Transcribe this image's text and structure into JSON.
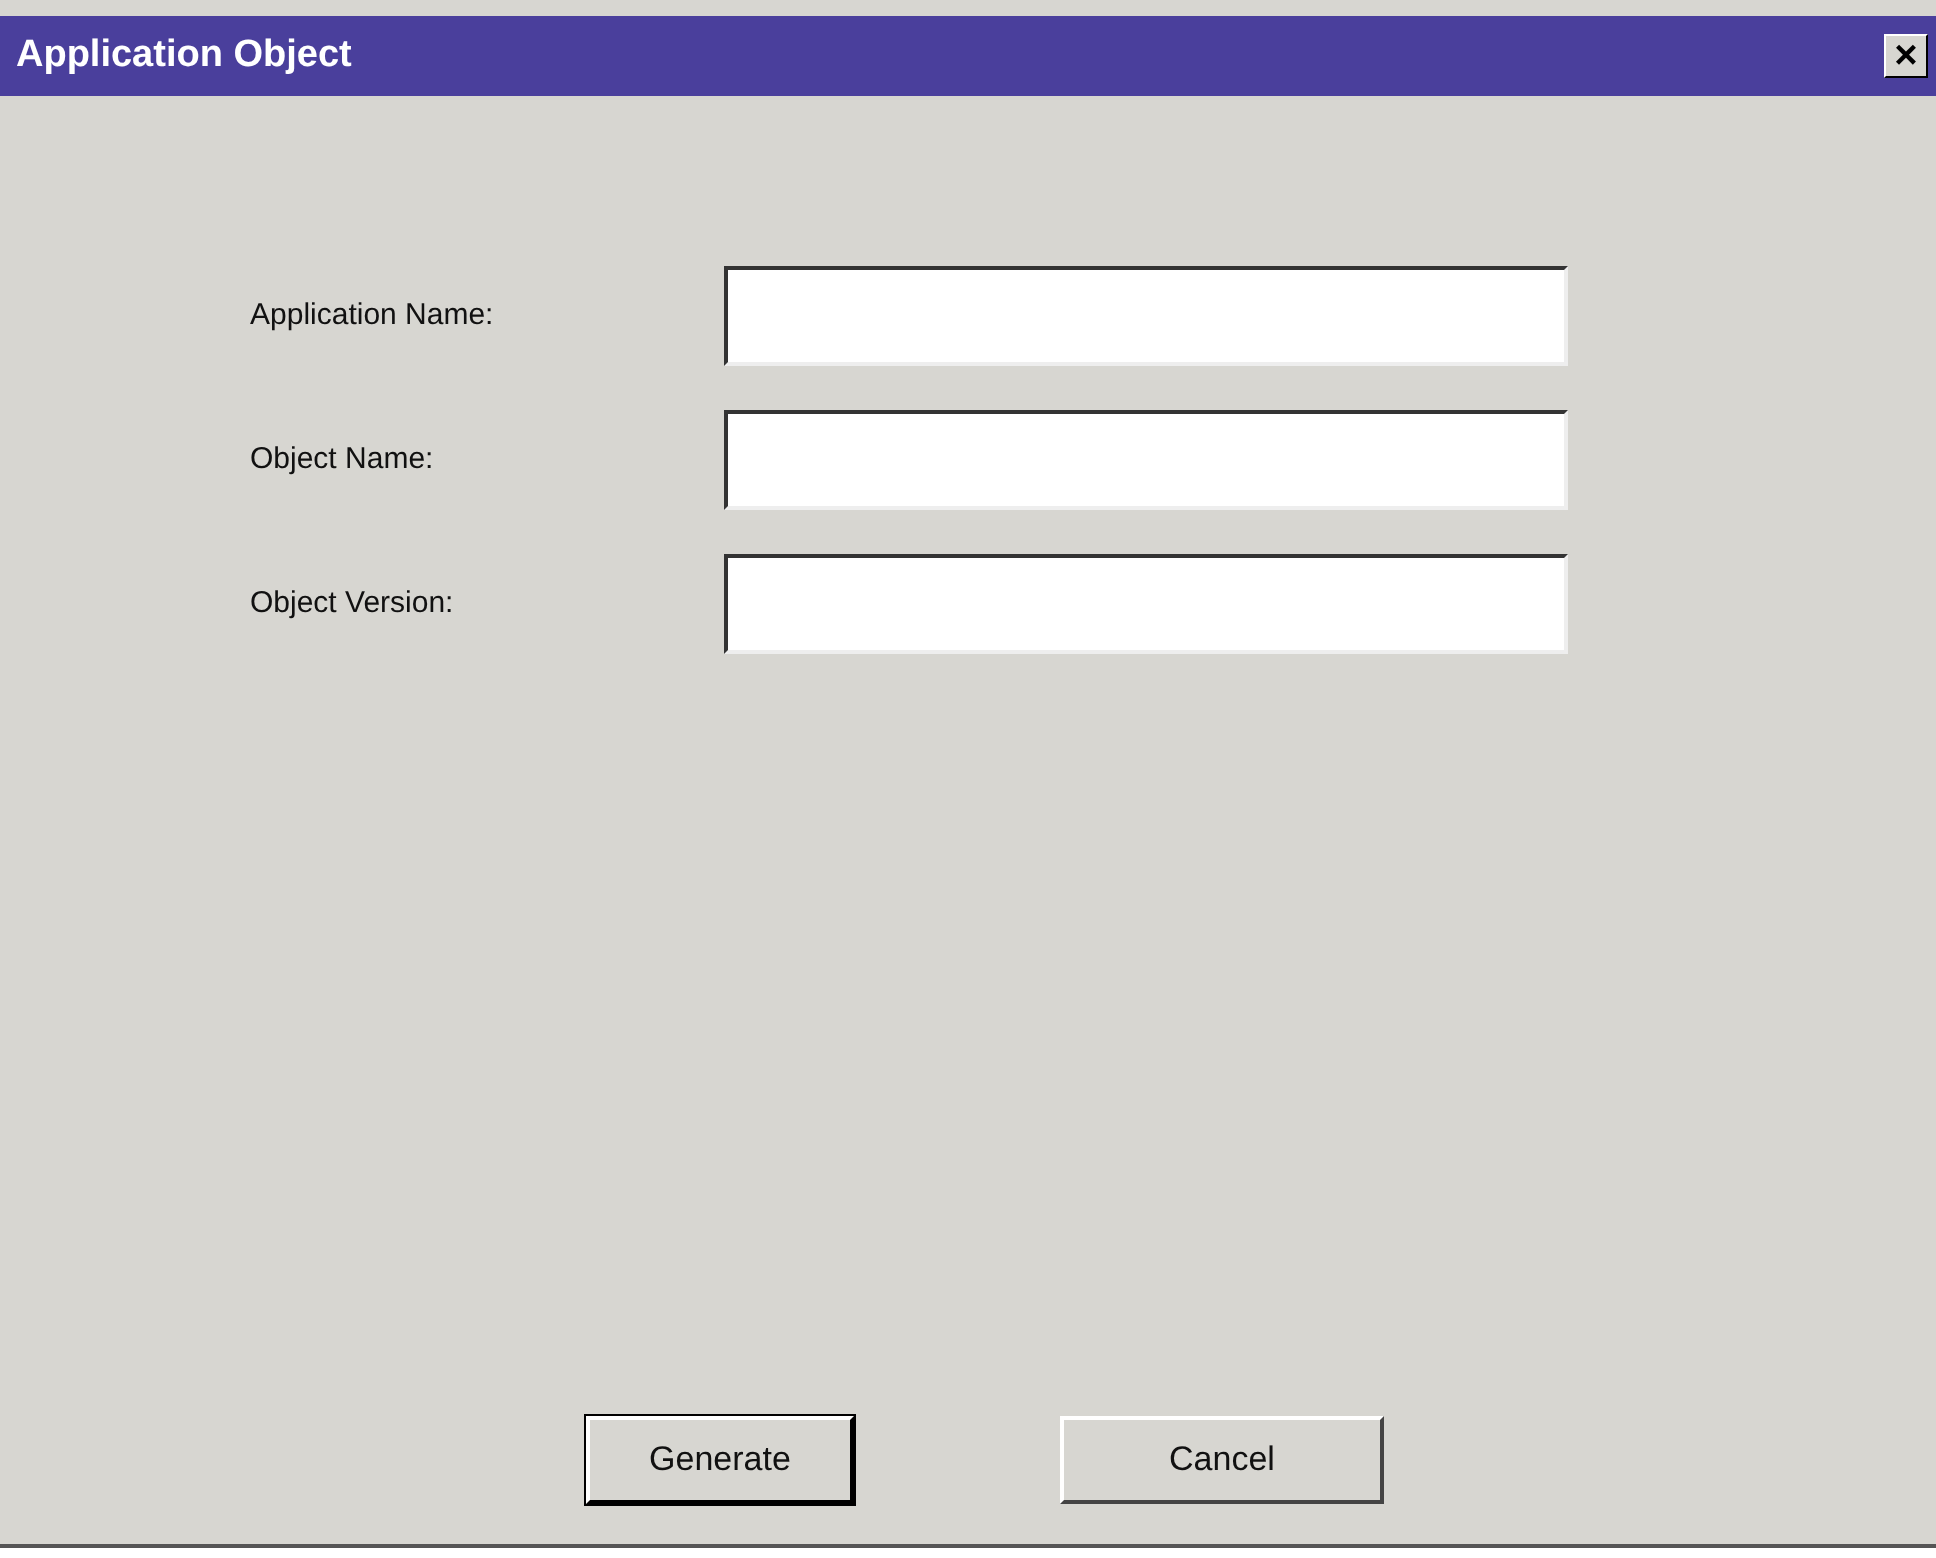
{
  "window": {
    "title": "Application Object",
    "close": "×"
  },
  "fields": [
    {
      "label": "Application Name:"
    },
    {
      "label": "Object Name:"
    },
    {
      "label": "Object Version:"
    }
  ],
  "buttons": [
    {
      "label": "Generate",
      "default": true
    },
    {
      "label": "Cancel",
      "default": false
    }
  ]
}
